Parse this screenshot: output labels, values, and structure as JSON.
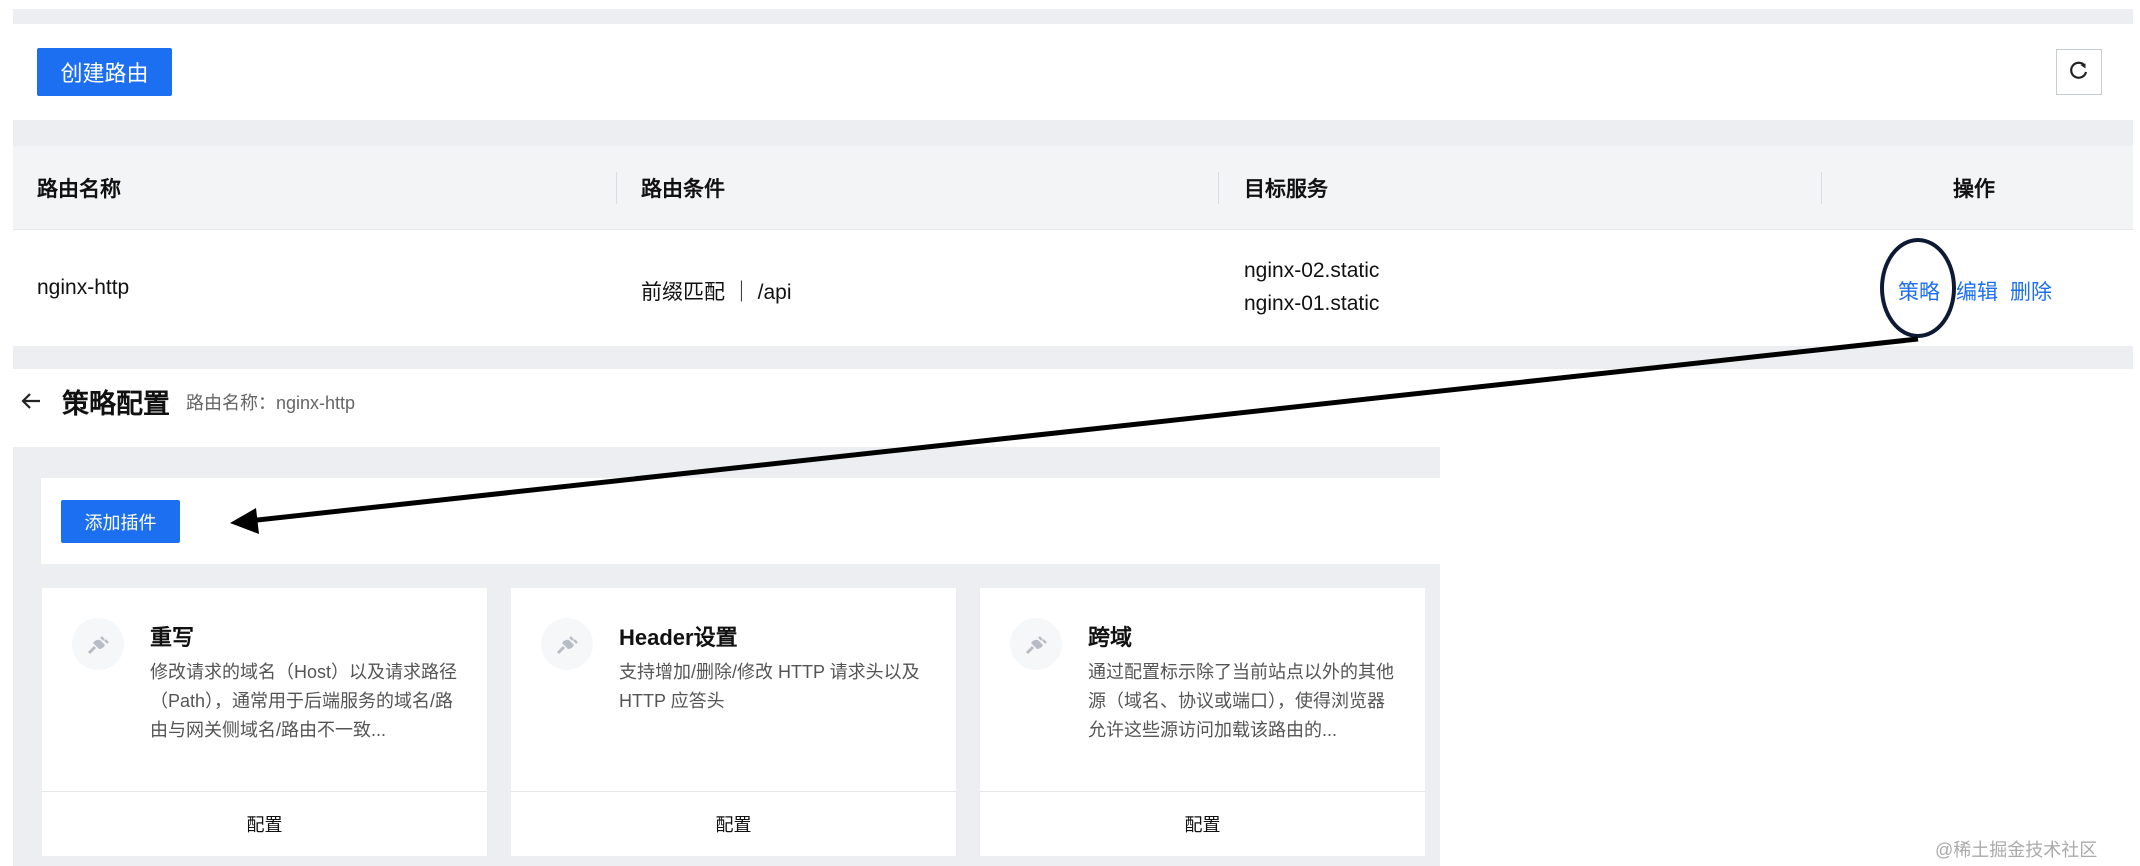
{
  "toolbar": {
    "create_label": "创建路由",
    "refresh_icon": "refresh-icon"
  },
  "table": {
    "headers": [
      "路由名称",
      "路由条件",
      "目标服务",
      "操作"
    ],
    "rows": [
      {
        "name": "nginx-http",
        "condition": "前缀匹配 ｜ /api",
        "services": [
          "nginx-02.static",
          "nginx-01.static"
        ],
        "actions": [
          "策略",
          "编辑",
          "删除"
        ]
      }
    ]
  },
  "strategy": {
    "back_icon": "arrow-left-icon",
    "title": "策略配置",
    "subtitle": "路由名称：nginx-http",
    "add_label": "添加插件"
  },
  "plugins": [
    {
      "icon": "plug-icon",
      "title": "重写",
      "desc": "修改请求的域名（Host）以及请求路径（Path），通常用于后端服务的域名/路由与网关侧域名/路由不一致...",
      "footer": "配置"
    },
    {
      "icon": "plug-icon",
      "title": "Header设置",
      "desc": "支持增加/删除/修改 HTTP 请求头以及 HTTP 应答头",
      "footer": "配置"
    },
    {
      "icon": "plug-icon",
      "title": "跨域",
      "desc": "通过配置标示除了当前站点以外的其他源（域名、协议或端口），使得浏览器允许这些源访问加载该路由的...",
      "footer": "配置"
    }
  ],
  "watermark": "@稀土掘金技术社区",
  "colors": {
    "primary": "#1d6ff2",
    "panel_bg": "#eceef2",
    "annotation": "#0e1a33"
  }
}
